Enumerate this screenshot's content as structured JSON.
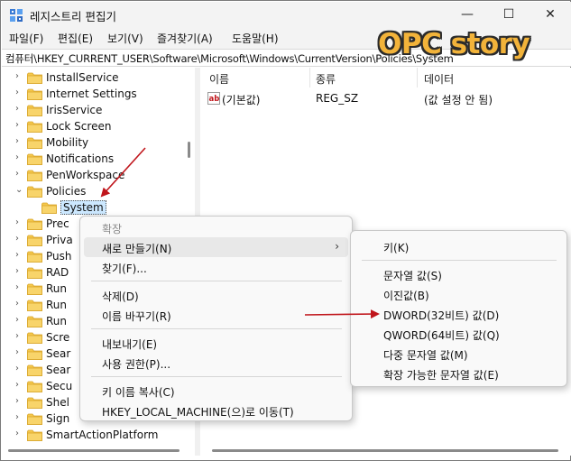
{
  "window": {
    "title": "레지스트리 편집기",
    "minimize_glyph": "—",
    "maximize_glyph": "☐",
    "close_glyph": "✕"
  },
  "menu": [
    "파일(F)",
    "편집(E)",
    "보기(V)",
    "즐겨찾기(A)",
    "도움말(H)"
  ],
  "address": "컴퓨터\\HKEY_CURRENT_USER\\Software\\Microsoft\\Windows\\CurrentVersion\\Policies\\System",
  "watermark": "OPC story",
  "tree": {
    "items": [
      {
        "label": "InstallService",
        "chevron": "›"
      },
      {
        "label": "Internet Settings",
        "chevron": "›"
      },
      {
        "label": "IrisService",
        "chevron": "›"
      },
      {
        "label": "Lock Screen",
        "chevron": "›"
      },
      {
        "label": "Mobility",
        "chevron": "›"
      },
      {
        "label": "Notifications",
        "chevron": "›"
      },
      {
        "label": "PenWorkspace",
        "chevron": "›"
      },
      {
        "label": "Policies",
        "chevron": "⌄"
      },
      {
        "label": "System",
        "chevron": ""
      },
      {
        "label": "Prec",
        "chevron": "›"
      },
      {
        "label": "Priva",
        "chevron": "›"
      },
      {
        "label": "Push",
        "chevron": "›"
      },
      {
        "label": "RAD",
        "chevron": "›"
      },
      {
        "label": "Run",
        "chevron": "›"
      },
      {
        "label": "Run",
        "chevron": "›"
      },
      {
        "label": "Run",
        "chevron": "›"
      },
      {
        "label": "Scre",
        "chevron": "›"
      },
      {
        "label": "Sear",
        "chevron": "›"
      },
      {
        "label": "Sear",
        "chevron": "›"
      },
      {
        "label": "Secu",
        "chevron": "›"
      },
      {
        "label": "Shel",
        "chevron": "›"
      },
      {
        "label": "Sign",
        "chevron": "›"
      },
      {
        "label": "SmartActionPlatform",
        "chevron": "›"
      }
    ]
  },
  "list": {
    "columns": [
      "이름",
      "종류",
      "데이터"
    ],
    "rows": [
      {
        "name": "(기본값)",
        "type": "REG_SZ",
        "data": "(값 설정 안 됨)",
        "icon": "string-value-icon"
      }
    ]
  },
  "context_menu": {
    "expand": "확장",
    "new": "새로 만들기(N)",
    "submenu_glyph": "›",
    "find": "찾기(F)...",
    "delete": "삭제(D)",
    "rename": "이름 바꾸기(R)",
    "export": "내보내기(E)",
    "permissions": "사용 권한(P)...",
    "copy_key_name": "키 이름 복사(C)",
    "goto_hklm": "HKEY_LOCAL_MACHINE(으)로 이동(T)"
  },
  "submenu": {
    "key": "키(K)",
    "string": "문자열 값(S)",
    "binary": "이진값(B)",
    "dword": "DWORD(32비트) 값(D)",
    "qword": "QWORD(64비트) 값(Q)",
    "multi_string": "다중 문자열 값(M)",
    "expandable_string": "확장 가능한 문자열 값(E)"
  },
  "colors": {
    "annotation_arrow": "#c0151b",
    "watermark_fill": "#f2b33a",
    "selection": "#cce8ff",
    "folder": "#f5c84c"
  }
}
